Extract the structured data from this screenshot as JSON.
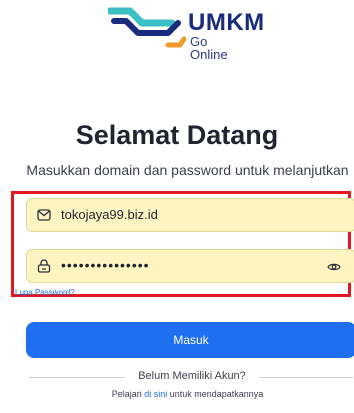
{
  "brand": {
    "name": "UMKM",
    "line1": "Go",
    "line2": "Online",
    "colors": {
      "primary": "#1a2a7c",
      "teal": "#3cbfc4",
      "orange": "#f09a2a"
    }
  },
  "header": {
    "title": "Selamat Datang",
    "subtitle": "Masukkan domain dan password untuk melanjutkan"
  },
  "form": {
    "domain": {
      "value": "tokojaya99.biz.id",
      "icon": "mail-icon"
    },
    "password": {
      "value": "•••••••••••••••",
      "icon": "lock-icon",
      "toggle_icon": "eye-icon"
    },
    "forgot_label": "Lupa Password?",
    "submit_label": "Masuk"
  },
  "footer": {
    "divider_text": "Belum Memiliki Akun?",
    "learn_prefix": "Pelajari ",
    "learn_link": "di sini",
    "learn_suffix": " untuk mendapatkannya"
  },
  "colors": {
    "field_bg": "#fdf4c2",
    "highlight": "#e3191f",
    "button": "#1f6ff0",
    "link": "#1d6ce0"
  }
}
